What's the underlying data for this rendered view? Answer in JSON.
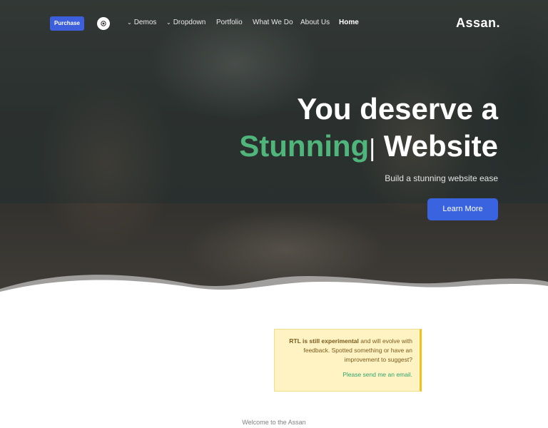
{
  "nav": {
    "purchase_label": "Purchase",
    "theme_toggle_icon": "sun-icon",
    "items": [
      {
        "label": "Demos",
        "has_dropdown": true
      },
      {
        "label": "Dropdown",
        "has_dropdown": true
      },
      {
        "label": "Portfolio",
        "has_dropdown": false
      },
      {
        "label": "What We Do",
        "has_dropdown": false
      },
      {
        "label": "About Us",
        "has_dropdown": false
      },
      {
        "label": "Home",
        "has_dropdown": false,
        "active": true
      }
    ],
    "logo": "Assan."
  },
  "hero": {
    "title_line1": "You deserve a",
    "title_accent": "Stunning",
    "title_cursor": "|",
    "title_line2_rest": " Website",
    "subtitle": "Build a stunning website ease",
    "cta_label": "Learn More"
  },
  "alert": {
    "strong": "RTL is still experimental",
    "text": " and will evolve with feedback. Spotted something or have an improvement to suggest?",
    "link_text": "Please send me an email."
  },
  "welcome": "Welcome to the Assan",
  "colors": {
    "accent_green": "#4fb57b",
    "primary_blue": "#3a63e0",
    "alert_bg": "#fff3c4"
  }
}
